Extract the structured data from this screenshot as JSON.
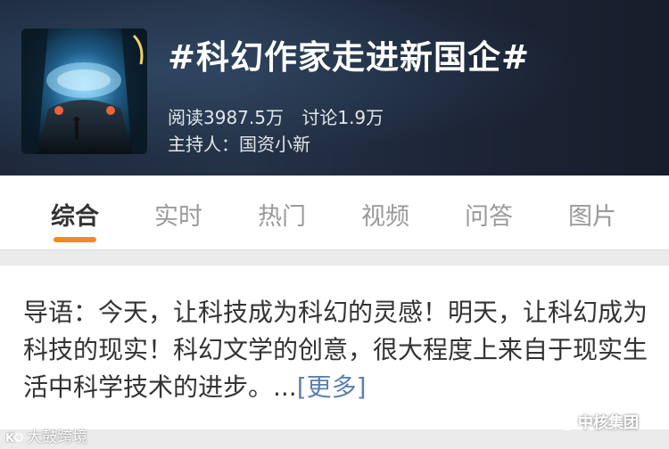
{
  "header": {
    "topic_title": "#科幻作家走进新国企#",
    "reads_label": "阅读3987.5万",
    "discussion_label": "讨论1.9万",
    "host_label": "主持人：国资小新",
    "cover_image_icon": "sci-fi-spaceship-interior-image"
  },
  "tabs": {
    "items": [
      {
        "label": "综合"
      },
      {
        "label": "实时"
      },
      {
        "label": "热门"
      },
      {
        "label": "视频"
      },
      {
        "label": "问答"
      },
      {
        "label": "图片"
      }
    ],
    "active_index": 0
  },
  "intro": {
    "text": "导语：今天，让科技成为科幻的灵感！明天，让科幻成为科技的现实！科幻文学的创意，很大程度上来自于现实生活中科学技术的进步。...",
    "more_link": "[更多]"
  },
  "watermarks": {
    "left": "大鼓跨境",
    "left_logo_icon": "k-logo-icon",
    "right": "中核集团",
    "right_logo_icon": "wechat-logo-icon"
  },
  "colors": {
    "accent_orange": "#f28a21",
    "link_blue": "#5b7fb0",
    "header_bg": "#1e2a3c"
  }
}
